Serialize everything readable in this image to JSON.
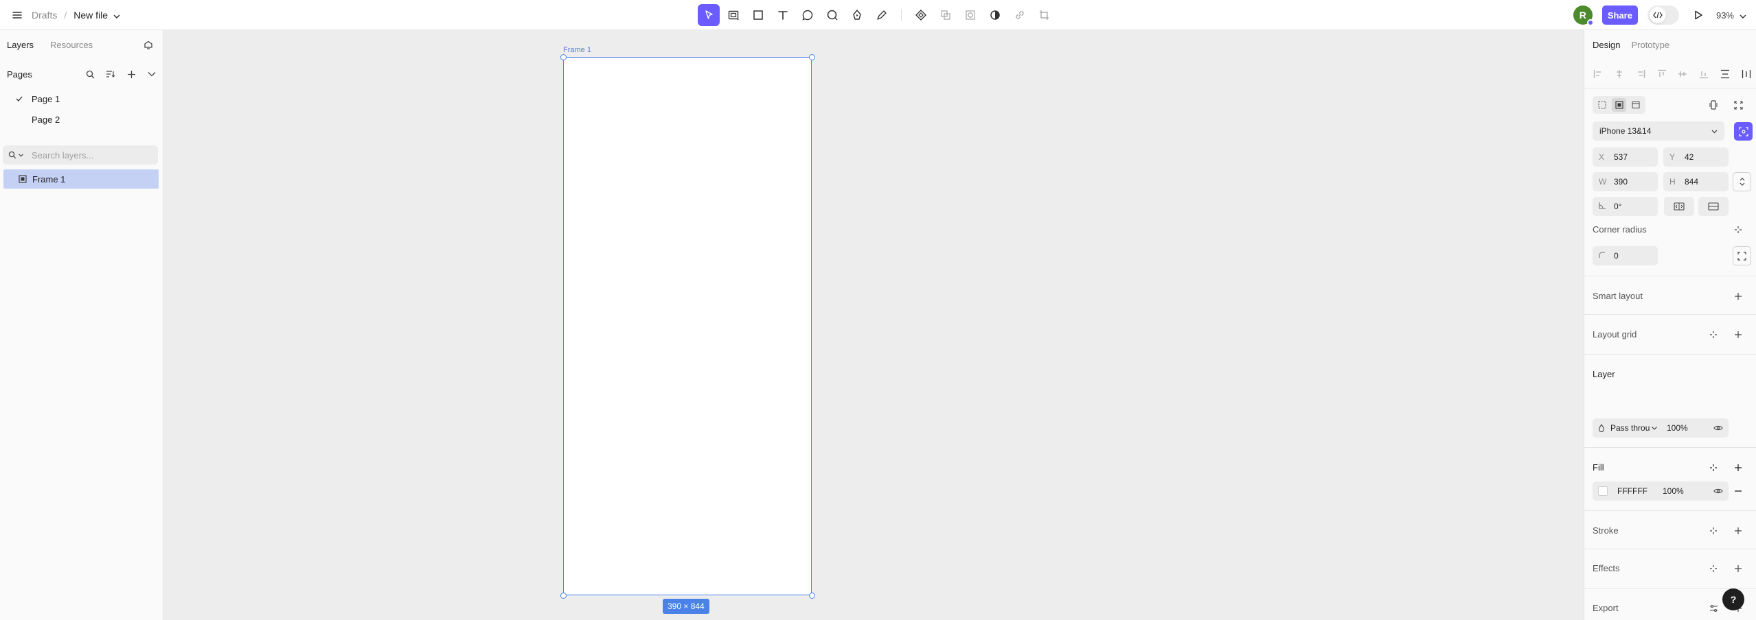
{
  "header": {
    "breadcrumb_root": "Drafts",
    "breadcrumb_sep": "/",
    "file_name": "New file",
    "avatar_initial": "R",
    "share_label": "Share",
    "zoom": "93%",
    "accent_color": "#6a5cff",
    "tools": [
      "move-tool",
      "frame-tool",
      "rectangle-tool",
      "text-tool",
      "comment-tool",
      "ellipse-tool",
      "pen-tool",
      "pencil-tool",
      "component-tool",
      "instance-tool",
      "crop-tool",
      "mask-tool",
      "link-tool",
      "image-tool"
    ]
  },
  "left_panel": {
    "tabs": [
      "Layers",
      "Resources"
    ],
    "pages_label": "Pages",
    "pages": [
      "Page 1",
      "Page 2"
    ],
    "current_page": "Page 1",
    "search_placeholder": "Search layers...",
    "layers": [
      "Frame 1"
    ]
  },
  "canvas": {
    "frame_name": "Frame 1",
    "size_badge": "390 × 844",
    "selection_color": "#4a82e8"
  },
  "right_panel": {
    "tabs": [
      "Design",
      "Prototype"
    ],
    "device": "iPhone 13&14",
    "x_label": "X",
    "x_value": "537",
    "y_label": "Y",
    "y_value": "42",
    "w_label": "W",
    "w_value": "390",
    "h_label": "H",
    "h_value": "844",
    "rotation": "0°",
    "corner_radius_label": "Corner radius",
    "corner_radius_value": "0",
    "smart_layout_label": "Smart layout",
    "layout_grid_label": "Layout grid",
    "layer_label": "Layer",
    "blend_mode": "Pass throu",
    "layer_opacity": "100%",
    "fill_label": "Fill",
    "fill_hex": "FFFFFF",
    "fill_opacity": "100%",
    "stroke_label": "Stroke",
    "effects_label": "Effects",
    "export_label": "Export",
    "help_label": "?"
  }
}
